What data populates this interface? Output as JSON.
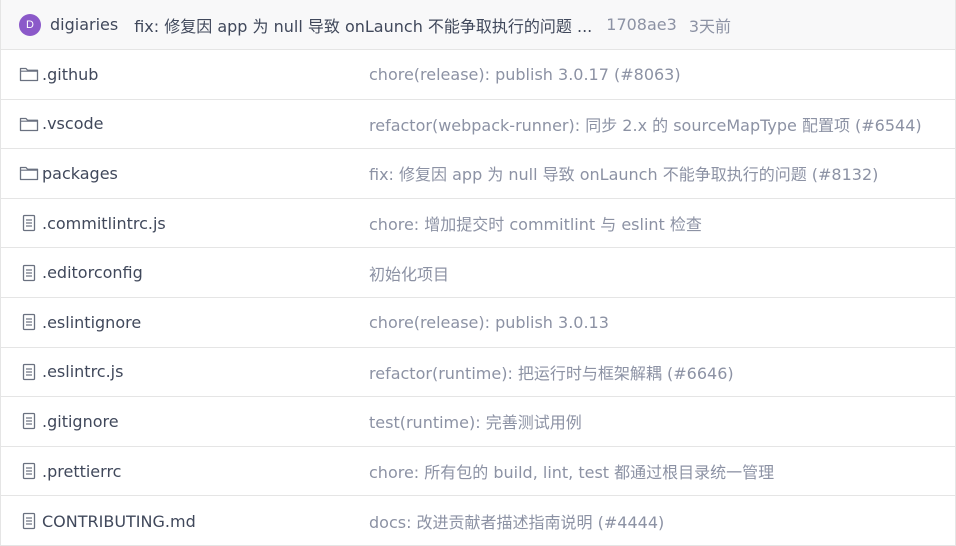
{
  "commit": {
    "avatar_letter": "D",
    "author": "digiaries",
    "message": "fix: 修复因 app 为 null 导致 onLaunch 不能争取执行的问题 ...",
    "sha": "1708ae3",
    "time": "3天前"
  },
  "colors": {
    "avatar_bg": "#8b59c9",
    "text_primary": "#40485b",
    "text_secondary": "#8c92a4",
    "header_bg": "#f8f8f9",
    "border": "#e5e5e5"
  },
  "files": [
    {
      "type": "folder",
      "icon": "folder-icon",
      "name": ".github",
      "message": "chore(release): publish 3.0.17 (#8063)"
    },
    {
      "type": "folder",
      "icon": "folder-icon",
      "name": ".vscode",
      "message": "refactor(webpack-runner): 同步 2.x 的 sourceMapType 配置项 (#6544)"
    },
    {
      "type": "folder",
      "icon": "folder-icon",
      "name": "packages",
      "message": "fix: 修复因 app 为 null 导致 onLaunch 不能争取执行的问题 (#8132)"
    },
    {
      "type": "file",
      "icon": "file-icon",
      "name": ".commitlintrc.js",
      "message": "chore: 增加提交时 commitlint 与 eslint 检查"
    },
    {
      "type": "file",
      "icon": "file-icon",
      "name": ".editorconfig",
      "message": "初始化项目"
    },
    {
      "type": "file",
      "icon": "file-icon",
      "name": ".eslintignore",
      "message": "chore(release): publish 3.0.13"
    },
    {
      "type": "file",
      "icon": "file-icon",
      "name": ".eslintrc.js",
      "message": "refactor(runtime): 把运行时与框架解耦 (#6646)"
    },
    {
      "type": "file",
      "icon": "file-icon",
      "name": ".gitignore",
      "message": "test(runtime): 完善测试用例"
    },
    {
      "type": "file",
      "icon": "file-icon",
      "name": ".prettierrc",
      "message": "chore: 所有包的 build, lint, test 都通过根目录统一管理"
    },
    {
      "type": "file",
      "icon": "file-icon",
      "name": "CONTRIBUTING.md",
      "message": "docs: 改进贡献者描述指南说明 (#4444)"
    }
  ]
}
